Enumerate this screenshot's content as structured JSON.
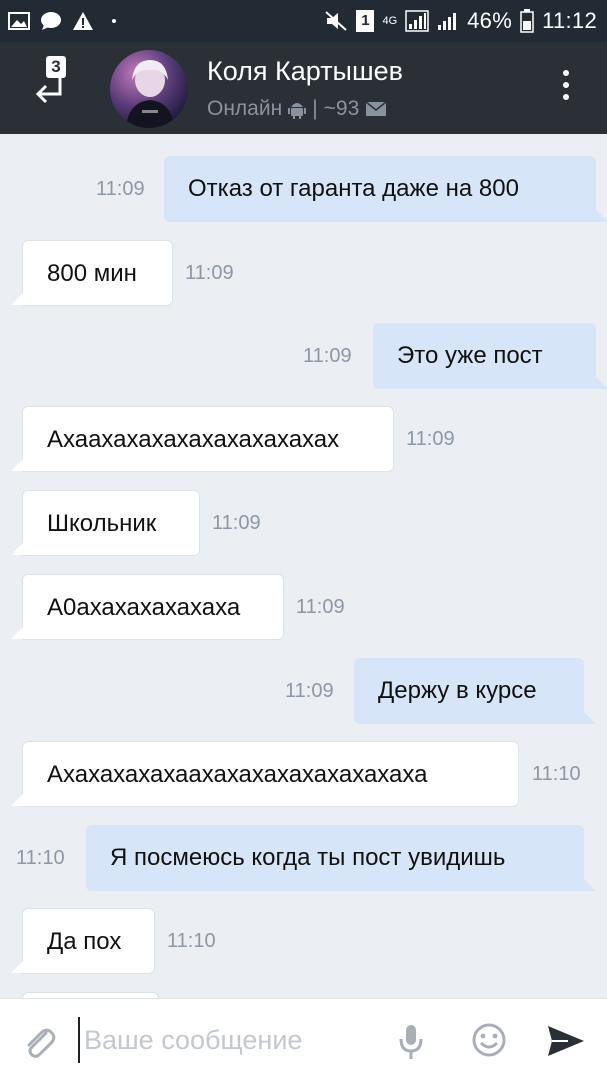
{
  "statusbar": {
    "network": "4G",
    "battery": "46%",
    "time": "11:12",
    "sim_badge": "1"
  },
  "header": {
    "back_badge": "3",
    "name": "Коля Картышев",
    "status": "Онлайн",
    "separator": "|",
    "followers": "~93"
  },
  "messages": [
    {
      "dir": "out",
      "text": "Отказ от гаранта даже на 800",
      "time": "11:09"
    },
    {
      "dir": "in",
      "text": "800 мин",
      "time": "11:09"
    },
    {
      "dir": "out",
      "text": "Это уже пост",
      "time": "11:09"
    },
    {
      "dir": "in",
      "text": "Ахаахахахахахахахахахах",
      "time": "11:09"
    },
    {
      "dir": "in",
      "text": "Школьник",
      "time": "11:09"
    },
    {
      "dir": "in",
      "text": "А0ахахахахахаха",
      "time": "11:09"
    },
    {
      "dir": "out",
      "text": "Держу в курсе",
      "time": "11:09"
    },
    {
      "dir": "in",
      "text": "Ахахахахахаахахахахахахахахаха",
      "time": "11:10"
    },
    {
      "dir": "out",
      "text": "Я посмеюсь когда ты пост увидишь",
      "time": "11:10"
    },
    {
      "dir": "in",
      "text": "Да пох",
      "time": "11:10"
    }
  ],
  "input": {
    "placeholder": "Ваше сообщение",
    "value": ""
  },
  "colors": {
    "header_bg": "#2a3036",
    "chat_bg": "#ebeef2",
    "out_bubble": "#d6e5f7",
    "in_bubble": "#ffffff",
    "time_text": "#8c98a6"
  }
}
